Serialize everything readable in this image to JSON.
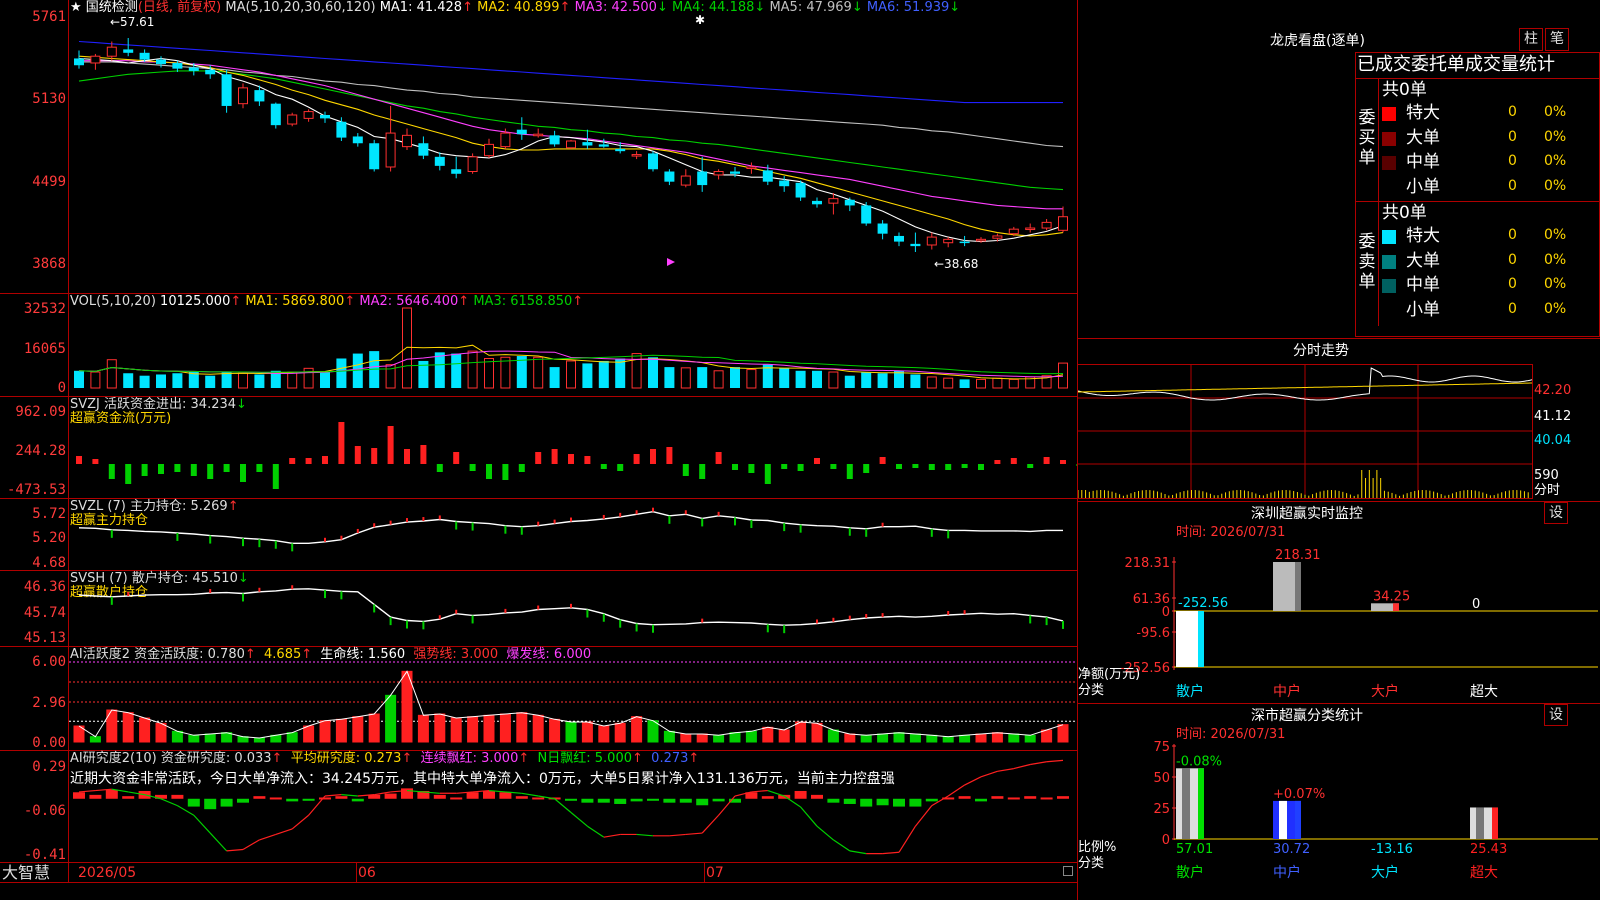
{
  "colors": {
    "up": "#ff3030",
    "down": "#00e5ff",
    "ma1": "#ffffff",
    "ma2": "#ffd700",
    "ma3": "#ff40ff",
    "ma4": "#00d000",
    "ma5": "#c0c0c0",
    "ma6": "#2020ff",
    "grid": "#b00000",
    "axis": "#ff3b3b"
  },
  "header": {
    "star": "★",
    "stock_name": "国统检测",
    "period": "(日线, 前复权)",
    "ma_label": "MA(5,10,20,30,60,120)",
    "ma1": "MA1: 41.428",
    "ma2": "MA2: 40.899",
    "ma3": "MA3: 42.500",
    "ma4": "MA4: 44.188",
    "ma5": "MA5: 47.969",
    "ma6": "MA6: 51.939",
    "up_arrow": "↑",
    "down_arrow": "↓"
  },
  "main_chart": {
    "y_labels": [
      "5761",
      "5130",
      "4499",
      "3868"
    ],
    "high_note": "←57.61",
    "low_note": "←38.68",
    "candles": [
      [
        55.8,
        56.5,
        54.9,
        55.2
      ],
      [
        55.4,
        56.2,
        54.8,
        56.0
      ],
      [
        56.0,
        57.3,
        55.6,
        56.8
      ],
      [
        56.6,
        57.61,
        56.0,
        56.3
      ],
      [
        56.3,
        56.6,
        55.5,
        55.7
      ],
      [
        55.7,
        56.0,
        55.0,
        55.3
      ],
      [
        55.4,
        55.6,
        54.6,
        54.9
      ],
      [
        55.0,
        55.4,
        54.3,
        54.7
      ],
      [
        54.8,
        55.2,
        54.0,
        54.4
      ],
      [
        54.4,
        54.8,
        51.0,
        51.6
      ],
      [
        51.8,
        53.6,
        51.4,
        53.2
      ],
      [
        53.0,
        53.4,
        51.6,
        52.0
      ],
      [
        51.8,
        51.9,
        49.6,
        49.9
      ],
      [
        50.0,
        51.0,
        49.8,
        50.8
      ],
      [
        50.5,
        51.3,
        50.2,
        51.1
      ],
      [
        50.8,
        51.1,
        50.1,
        50.5
      ],
      [
        50.2,
        50.6,
        48.5,
        48.8
      ],
      [
        48.9,
        49.2,
        48.0,
        48.3
      ],
      [
        48.3,
        48.6,
        45.8,
        46.0
      ],
      [
        46.2,
        51.6,
        45.8,
        49.2
      ],
      [
        48.0,
        49.6,
        47.7,
        49.0
      ],
      [
        48.3,
        48.9,
        46.9,
        47.2
      ],
      [
        47.1,
        47.5,
        45.9,
        46.3
      ],
      [
        46.0,
        47.1,
        45.2,
        45.6
      ],
      [
        45.8,
        47.4,
        45.6,
        47.1
      ],
      [
        47.2,
        48.7,
        47.0,
        48.2
      ],
      [
        48.0,
        49.6,
        47.8,
        49.2
      ],
      [
        49.5,
        50.6,
        48.6,
        49.1
      ],
      [
        49.0,
        49.6,
        48.8,
        49.1
      ],
      [
        49.0,
        49.4,
        48.0,
        48.2
      ],
      [
        47.9,
        48.6,
        47.8,
        48.5
      ],
      [
        48.4,
        49.5,
        47.8,
        48.1
      ],
      [
        48.2,
        48.7,
        47.9,
        48.0
      ],
      [
        47.8,
        48.4,
        47.4,
        47.6
      ],
      [
        47.3,
        47.6,
        46.9,
        47.3
      ],
      [
        47.4,
        47.6,
        45.8,
        46.0
      ],
      [
        45.8,
        46.0,
        44.6,
        44.9
      ],
      [
        44.6,
        46.0,
        44.4,
        45.4
      ],
      [
        45.8,
        47.1,
        44.0,
        44.6
      ],
      [
        45.5,
        46.0,
        45.1,
        45.8
      ],
      [
        45.8,
        46.2,
        45.3,
        45.6
      ],
      [
        46.1,
        46.6,
        45.6,
        46.2
      ],
      [
        45.9,
        46.4,
        44.6,
        44.9
      ],
      [
        45.0,
        45.4,
        44.0,
        44.5
      ],
      [
        44.8,
        45.0,
        43.2,
        43.5
      ],
      [
        43.2,
        43.5,
        42.6,
        42.9
      ],
      [
        43.0,
        43.9,
        42.0,
        43.4
      ],
      [
        43.3,
        43.5,
        42.3,
        42.8
      ],
      [
        42.8,
        43.1,
        41.0,
        41.2
      ],
      [
        41.2,
        41.5,
        39.8,
        40.3
      ],
      [
        40.1,
        40.4,
        39.2,
        39.6
      ],
      [
        39.4,
        40.4,
        38.68,
        39.2
      ],
      [
        39.3,
        40.4,
        38.9,
        40.0
      ],
      [
        39.5,
        40.0,
        39.1,
        39.8
      ],
      [
        39.6,
        40.1,
        39.2,
        39.5
      ],
      [
        39.7,
        40.0,
        39.5,
        39.8
      ],
      [
        39.9,
        40.3,
        39.6,
        40.1
      ],
      [
        40.3,
        40.9,
        40.1,
        40.7
      ],
      [
        40.7,
        41.2,
        40.4,
        40.8
      ],
      [
        40.8,
        41.6,
        40.6,
        41.3
      ],
      [
        40.6,
        42.7,
        40.4,
        41.8
      ]
    ],
    "ma1": [
      55.8,
      55.7,
      55.6,
      55.4,
      55.6,
      55.8,
      55.6,
      55.2,
      54.9,
      54.2,
      53.8,
      53.3,
      52.6,
      52.2,
      51.5,
      50.7,
      50.2,
      49.7,
      48.9,
      48.7,
      48.3,
      47.9,
      47.4,
      47.2,
      47.1,
      47.0,
      47.3,
      47.8,
      48.5,
      48.9,
      48.8,
      48.6,
      48.4,
      48.1,
      48.0,
      47.6,
      47.0,
      46.4,
      45.8,
      45.5,
      45.5,
      45.3,
      45.3,
      45.1,
      44.9,
      44.2,
      43.8,
      43.3,
      42.8,
      42.3,
      41.6,
      40.9,
      40.4,
      40.0,
      39.7,
      39.6,
      39.7,
      39.9,
      40.2,
      40.5,
      41.0
    ],
    "ma2": [
      56.0,
      55.9,
      55.8,
      55.7,
      55.6,
      55.5,
      55.4,
      55.2,
      55.0,
      54.6,
      54.3,
      53.9,
      53.5,
      53.0,
      52.6,
      52.1,
      51.7,
      51.3,
      50.8,
      50.4,
      50.0,
      49.6,
      49.2,
      48.8,
      48.3,
      48.0,
      47.8,
      47.7,
      47.7,
      47.8,
      47.8,
      47.8,
      47.8,
      47.8,
      47.8,
      47.8,
      47.6,
      47.3,
      46.9,
      46.7,
      46.4,
      46.1,
      45.8,
      45.5,
      45.2,
      44.8,
      44.4,
      44.0,
      43.6,
      43.2,
      42.8,
      42.4,
      42.0,
      41.6,
      41.1,
      40.7,
      40.4,
      40.2,
      40.1,
      40.2,
      40.4
    ],
    "ma3": [
      55.6,
      55.6,
      55.6,
      55.6,
      55.5,
      55.5,
      55.4,
      55.3,
      55.2,
      55.0,
      54.8,
      54.6,
      54.3,
      54.0,
      53.7,
      53.4,
      53.0,
      52.6,
      52.2,
      51.8,
      51.4,
      51.0,
      50.6,
      50.2,
      49.8,
      49.5,
      49.3,
      49.1,
      49.0,
      48.9,
      48.8,
      48.7,
      48.5,
      48.3,
      48.1,
      47.9,
      47.7,
      47.5,
      47.2,
      46.9,
      46.6,
      46.3,
      46.1,
      45.9,
      45.7,
      45.5,
      45.3,
      45.1,
      44.8,
      44.5,
      44.2,
      43.9,
      43.6,
      43.4,
      43.2,
      43.0,
      42.8,
      42.7,
      42.6,
      42.5,
      42.5
    ],
    "ma4": [
      53.8,
      54.0,
      54.2,
      54.4,
      54.5,
      54.6,
      54.7,
      54.7,
      54.7,
      54.6,
      54.4,
      54.2,
      54.0,
      53.7,
      53.4,
      53.1,
      52.8,
      52.5,
      52.2,
      51.9,
      51.6,
      51.4,
      51.1,
      50.9,
      50.6,
      50.4,
      50.2,
      50.0,
      49.8,
      49.7,
      49.5,
      49.4,
      49.2,
      49.1,
      48.9,
      48.8,
      48.6,
      48.5,
      48.3,
      48.2,
      48.0,
      47.8,
      47.6,
      47.4,
      47.2,
      47.0,
      46.8,
      46.6,
      46.4,
      46.2,
      46.0,
      45.8,
      45.6,
      45.4,
      45.2,
      45.0,
      44.8,
      44.6,
      44.4,
      44.3,
      44.2
    ],
    "ma5": [
      55.5,
      55.5,
      55.5,
      55.4,
      55.3,
      55.2,
      55.1,
      55.0,
      54.9,
      54.8,
      54.6,
      54.5,
      54.3,
      54.2,
      54.0,
      53.8,
      53.7,
      53.5,
      53.4,
      53.2,
      53.0,
      52.9,
      52.7,
      52.6,
      52.4,
      52.3,
      52.2,
      52.1,
      52.0,
      51.9,
      51.8,
      51.7,
      51.6,
      51.5,
      51.4,
      51.3,
      51.2,
      51.1,
      51.0,
      50.9,
      50.8,
      50.7,
      50.6,
      50.5,
      50.4,
      50.3,
      50.2,
      50.1,
      50.0,
      49.9,
      49.7,
      49.6,
      49.4,
      49.3,
      49.1,
      48.9,
      48.7,
      48.5,
      48.3,
      48.1,
      48.0
    ],
    "ma6": [
      57.3,
      57.2,
      57.1,
      57.0,
      56.9,
      56.8,
      56.7,
      56.6,
      56.5,
      56.4,
      56.3,
      56.2,
      56.1,
      56.0,
      55.9,
      55.8,
      55.7,
      55.6,
      55.5,
      55.4,
      55.3,
      55.2,
      55.1,
      55.0,
      54.9,
      54.8,
      54.7,
      54.6,
      54.5,
      54.4,
      54.3,
      54.2,
      54.1,
      54.0,
      53.9,
      53.8,
      53.7,
      53.6,
      53.5,
      53.4,
      53.3,
      53.2,
      53.1,
      53.0,
      52.9,
      52.8,
      52.7,
      52.6,
      52.5,
      52.4,
      52.3,
      52.2,
      52.1,
      52.0,
      51.9,
      51.9,
      51.9,
      51.9,
      51.9,
      51.9,
      51.9
    ]
  },
  "vol_chart": {
    "header": "VOL(5,10,20)",
    "value": "10125.000",
    "ma1": "MA1: 5869.800",
    "ma2": "MA2: 5646.400",
    "ma3": "MA3: 6158.850",
    "y_labels": [
      "32532",
      "16065",
      "0"
    ],
    "values": [
      7000,
      6500,
      11500,
      6000,
      5000,
      5500,
      6000,
      6500,
      5000,
      6500,
      6000,
      5500,
      7000,
      6500,
      8000,
      6500,
      12000,
      14000,
      15000,
      9500,
      32532,
      11000,
      14500,
      14000,
      15000,
      12000,
      12500,
      13000,
      12500,
      8500,
      11000,
      10000,
      11000,
      12000,
      14000,
      12500,
      8500,
      8200,
      8500,
      7000,
      8500,
      7500,
      9500,
      8000,
      7000,
      7000,
      6500,
      5000,
      6500,
      6000,
      7000,
      5500,
      4500,
      4000,
      3500,
      3500,
      4000,
      3500,
      4500,
      5000,
      10125
    ]
  },
  "svzj": {
    "header": "SVZJ  活跃资金进出: 34.234",
    "subtitle": "超赢资金流(万元)",
    "y_labels": [
      "962.09",
      "244.28",
      "-473.53"
    ],
    "values": [
      80,
      50,
      -150,
      -200,
      -120,
      -100,
      -80,
      -120,
      -150,
      -80,
      -180,
      -80,
      -250,
      60,
      60,
      80,
      420,
      180,
      160,
      380,
      150,
      190,
      -80,
      120,
      -70,
      -150,
      -160,
      -80,
      120,
      150,
      100,
      80,
      -50,
      -70,
      100,
      150,
      170,
      -120,
      -150,
      120,
      -60,
      -90,
      -200,
      -50,
      -70,
      60,
      -50,
      -150,
      -90,
      70,
      -50,
      -40,
      -60,
      -60,
      -40,
      -60,
      40,
      60,
      -40,
      70,
      40,
      -20
    ]
  },
  "svzl": {
    "header": "SVZL (7) 主力持仓: 5.269",
    "subtitle": "超赢主力持仓",
    "y_labels": [
      "5.72",
      "5.20",
      "4.68"
    ],
    "values": [
      5.32,
      5.31,
      5.28,
      5.27,
      5.25,
      5.24,
      5.22,
      5.2,
      5.17,
      5.15,
      5.12,
      5.1,
      5.07,
      5.02,
      5.02,
      5.05,
      5.09,
      5.22,
      5.33,
      5.38,
      5.43,
      5.45,
      5.48,
      5.44,
      5.42,
      5.4,
      5.36,
      5.34,
      5.36,
      5.4,
      5.44,
      5.46,
      5.49,
      5.53,
      5.58,
      5.63,
      5.55,
      5.58,
      5.5,
      5.55,
      5.52,
      5.47,
      5.46,
      5.41,
      5.38,
      5.36,
      5.35,
      5.32,
      5.3,
      5.34,
      5.34,
      5.35,
      5.3,
      5.27,
      5.27,
      5.26,
      5.26,
      5.26,
      5.25,
      5.27,
      5.27
    ]
  },
  "svsh": {
    "header": "SVSH (7) 散户持仓: 45.510",
    "subtitle": "超赢散户持仓",
    "y_labels": [
      "46.36",
      "45.74",
      "45.13"
    ],
    "values": [
      46.12,
      46.1,
      46.08,
      46.1,
      46.12,
      46.13,
      46.13,
      46.14,
      46.17,
      46.18,
      46.16,
      46.2,
      46.22,
      46.26,
      46.27,
      46.24,
      46.21,
      46.2,
      45.9,
      45.6,
      45.52,
      45.5,
      45.55,
      45.68,
      45.64,
      45.66,
      45.7,
      45.72,
      45.78,
      45.8,
      45.82,
      45.78,
      45.68,
      45.54,
      45.45,
      45.42,
      45.43,
      45.44,
      45.47,
      45.48,
      45.47,
      45.46,
      45.43,
      45.41,
      45.42,
      45.45,
      45.49,
      45.54,
      45.58,
      45.6,
      45.62,
      45.6,
      45.62,
      45.65,
      45.67,
      45.69,
      45.67,
      45.68,
      45.64,
      45.6,
      45.51
    ]
  },
  "ai_active": {
    "header": "AI活跃度2 资金活跃度: 0.780",
    "val2": "4.685",
    "life": "生命线: 1.560",
    "strong": "强势线: 3.000",
    "burst": "爆发线: 6.000",
    "y_labels": [
      "6.00",
      "2.96",
      "0.00"
    ],
    "values": [
      1.2,
      0.4,
      2.4,
      2.2,
      1.8,
      1.4,
      0.8,
      0.5,
      0.6,
      0.7,
      0.4,
      0.3,
      0.5,
      0.7,
      1.2,
      1.6,
      1.7,
      1.9,
      2.1,
      3.5,
      5.3,
      2.0,
      2.1,
      1.8,
      1.9,
      2.0,
      2.1,
      2.2,
      2.0,
      1.7,
      1.5,
      1.5,
      1.2,
      1.4,
      1.9,
      1.6,
      0.8,
      0.6,
      0.6,
      0.5,
      0.7,
      0.8,
      1.1,
      0.9,
      1.5,
      1.4,
      0.9,
      0.6,
      0.5,
      0.6,
      0.7,
      0.6,
      0.5,
      0.4,
      0.5,
      0.6,
      0.7,
      0.6,
      0.5,
      0.9,
      1.3
    ],
    "ups": [
      1,
      0,
      1,
      1,
      1,
      1,
      0,
      0,
      0,
      0,
      0,
      0,
      0,
      0,
      1,
      1,
      1,
      1,
      1,
      0,
      1,
      1,
      1,
      1,
      1,
      1,
      1,
      1,
      1,
      1,
      0,
      1,
      1,
      1,
      1,
      0,
      0,
      1,
      1,
      0,
      0,
      0,
      1,
      1,
      1,
      1,
      0,
      1,
      0,
      0,
      0,
      0,
      0,
      0,
      0,
      1,
      1,
      0,
      0,
      1,
      1
    ]
  },
  "ai_research": {
    "header": "AI研究度2(10) 资金研究度: 0.033",
    "avg": "平均研究度: 0.273",
    "streak": "连续飘红: 3.000",
    "nday": "N日飘红: 5.000",
    "val": "0.273",
    "comment": "近期大资金非常活跃，今日大单净流入：34.245万元，其中特大单净流入：0万元，大单5日累计净入131.136万元，当前主力控盘强",
    "y_labels": [
      "0.29",
      "-0.06",
      "-0.41"
    ],
    "values": [
      0.05,
      0.03,
      0.07,
      0.02,
      0.06,
      0.03,
      0.03,
      -0.06,
      -0.08,
      -0.06,
      -0.03,
      0.02,
      0.01,
      -0.02,
      -0.01,
      0.01,
      0.02,
      -0.02,
      0.03,
      0.04,
      0.08,
      0.06,
      0.03,
      0.01,
      0.05,
      0.06,
      0.05,
      0.02,
      0.01,
      0.01,
      -0.01,
      -0.03,
      -0.03,
      -0.04,
      -0.02,
      -0.01,
      -0.03,
      -0.03,
      -0.05,
      -0.02,
      -0.03,
      0.05,
      0.02,
      0.03,
      0.06,
      0.03,
      -0.03,
      -0.04,
      -0.06,
      -0.05,
      -0.06,
      -0.06,
      -0.02,
      0.01,
      0.02,
      -0.02,
      0.02,
      0.01,
      0.02,
      0.01,
      0.02
    ],
    "line": [
      0.05,
      0.06,
      0.07,
      0.05,
      0.03,
      0.0,
      -0.05,
      -0.12,
      -0.25,
      -0.38,
      -0.37,
      -0.3,
      -0.26,
      -0.22,
      -0.12,
      0.02,
      0.03,
      0.02,
      0.03,
      0.05,
      0.06,
      0.05,
      0.04,
      0.04,
      0.05,
      0.06,
      0.05,
      0.04,
      0.02,
      0.0,
      -0.1,
      -0.2,
      -0.28,
      -0.26,
      -0.26,
      -0.27,
      -0.27,
      -0.26,
      -0.25,
      -0.12,
      0.02,
      0.05,
      0.06,
      0.02,
      -0.06,
      -0.2,
      -0.3,
      -0.38,
      -0.4,
      -0.4,
      -0.39,
      -0.2,
      -0.05,
      0.02,
      0.1,
      0.16,
      0.2,
      0.22,
      0.25,
      0.27,
      0.28
    ]
  },
  "timeline": {
    "brand": "大智慧",
    "labels": [
      "2026/05",
      "06",
      "07"
    ]
  },
  "right": {
    "dragon_title": "龙虎看盘(逐单)",
    "btn_bar": "柱",
    "btn_pen": "笔",
    "order_title": "已成交委托单成交量统计",
    "buy_label": "委买单",
    "sell_label": "委卖单",
    "buy_total": "共0单",
    "sell_total": "共0单",
    "buy_rows": [
      {
        "name": "特大",
        "count": "0",
        "pct": "0%"
      },
      {
        "name": "大单",
        "count": "0",
        "pct": "0%"
      },
      {
        "name": "中单",
        "count": "0",
        "pct": "0%"
      },
      {
        "name": "小单",
        "count": "0",
        "pct": "0%"
      }
    ],
    "sell_rows": [
      {
        "name": "特大",
        "count": "0",
        "pct": "0%"
      },
      {
        "name": "大单",
        "count": "0",
        "pct": "0%"
      },
      {
        "name": "中单",
        "count": "0",
        "pct": "0%"
      },
      {
        "name": "小单",
        "count": "0",
        "pct": "0%"
      }
    ],
    "intraday_title": "分时走势",
    "intraday_labels": [
      "42.20",
      "41.12",
      "40.04",
      "590",
      "分时"
    ],
    "monitor_title": "深圳超赢实时监控",
    "monitor_btn": "设",
    "monitor_time": "时间: 2026/07/31",
    "monitor_y": [
      "218.31",
      "61.36",
      "0",
      "-95.6",
      "-252.56"
    ],
    "monitor_bars": [
      {
        "label": "-252.56",
        "value": -252.56
      },
      {
        "label": "218.31",
        "value": 218.31
      },
      {
        "label": "34.25",
        "value": 34.25
      },
      {
        "label": "0",
        "value": 0
      }
    ],
    "monitor_axis_name": "净额(万元)",
    "monitor_class": "分类",
    "monitor_cats": [
      "散户",
      "中户",
      "大户",
      "超大"
    ],
    "class_title": "深市超赢分类统计",
    "class_btn": "设",
    "class_time": "时间: 2026/07/31",
    "class_y": [
      "75",
      "50",
      "25",
      "0"
    ],
    "class_bars": [
      {
        "value": 57.01,
        "label": "57.01",
        "delta": "-0.08%"
      },
      {
        "value": 30.72,
        "label": "30.72",
        "delta": "+0.07%"
      },
      {
        "value": 0,
        "label": "-13.16",
        "delta": ""
      },
      {
        "value": 25.43,
        "label": "25.43",
        "delta": ""
      }
    ],
    "class_axis_name": "比例%",
    "class_class": "分类",
    "class_cats": [
      "散户",
      "中户",
      "大户",
      "超大"
    ]
  }
}
